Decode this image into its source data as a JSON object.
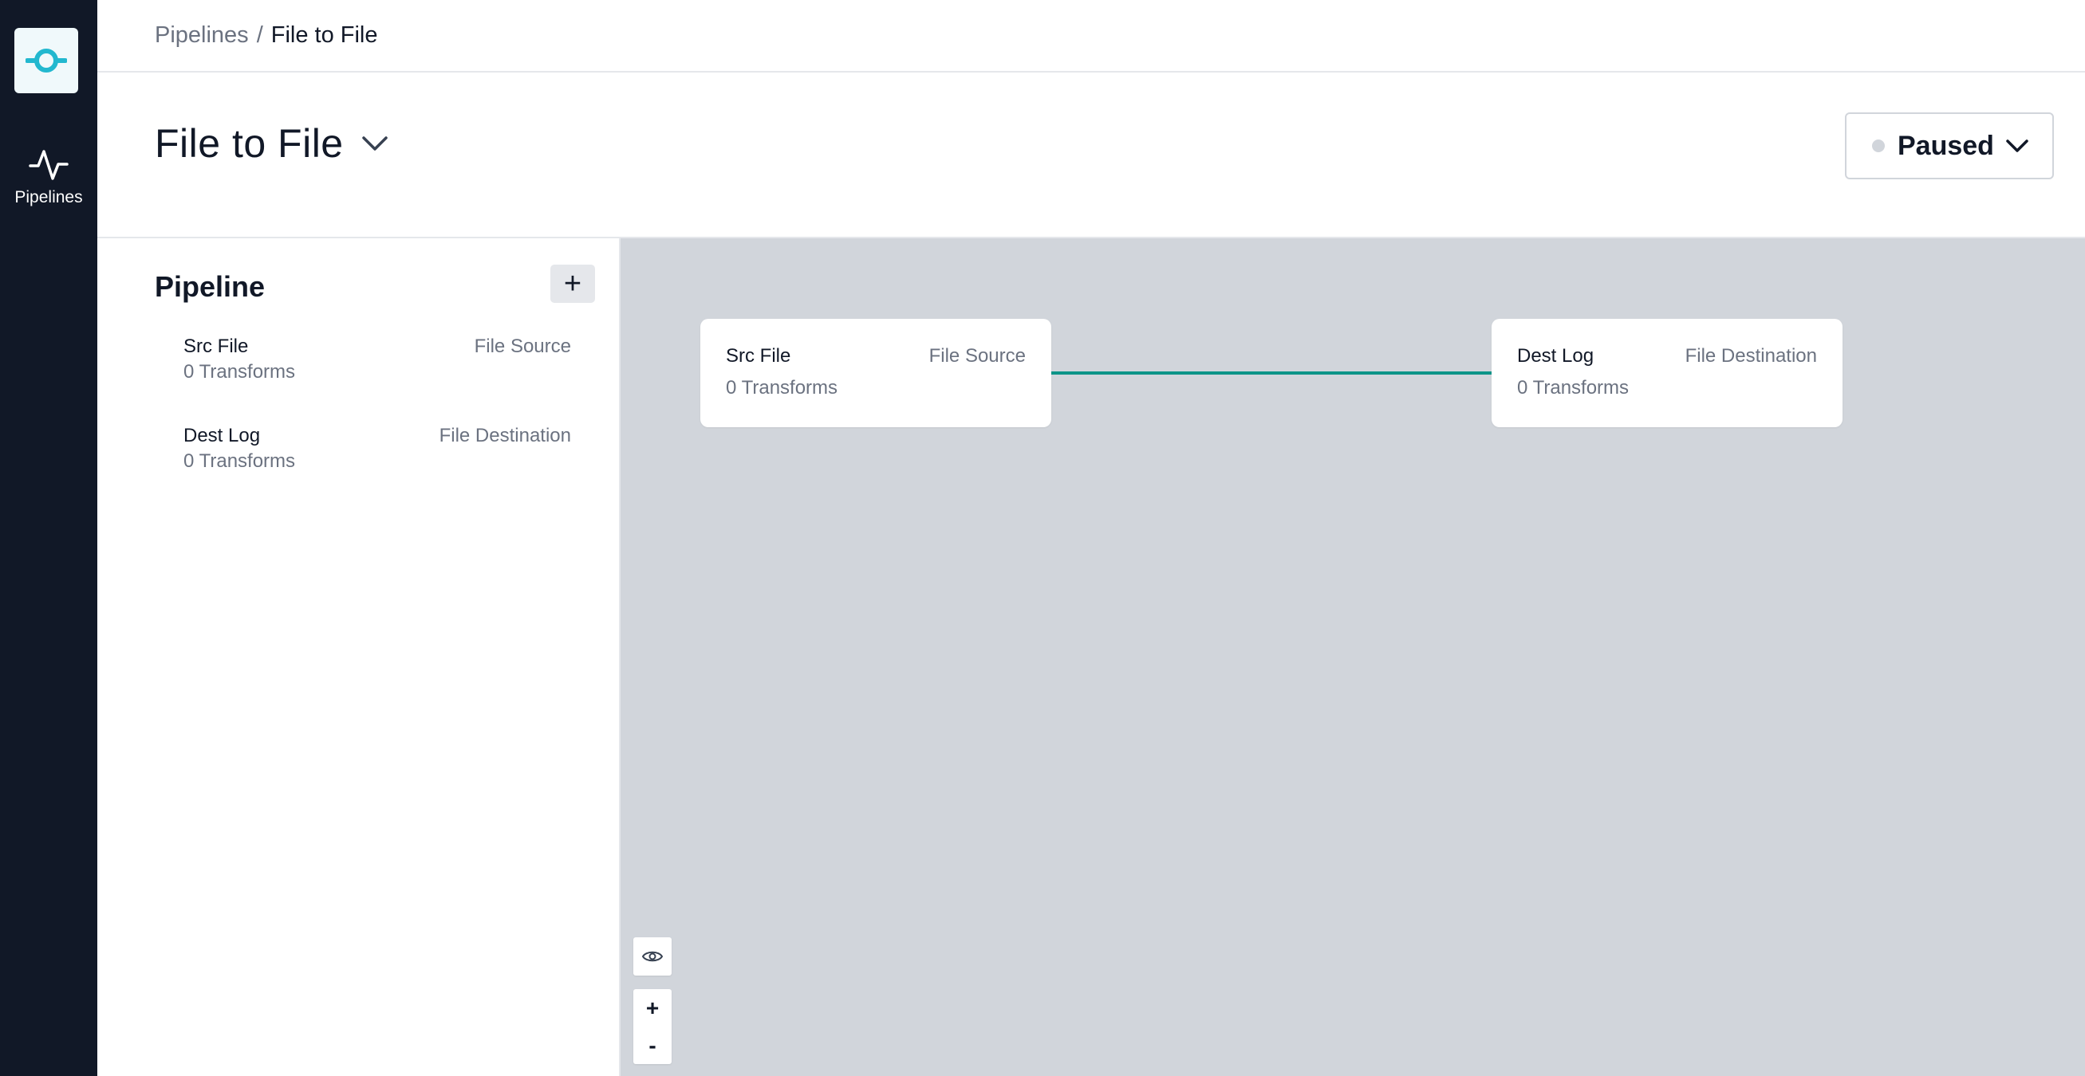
{
  "nav": {
    "logo_icon": "logo-icon",
    "items": [
      {
        "label": "Pipelines",
        "icon": "activity-pulse-icon"
      }
    ]
  },
  "breadcrumb": {
    "parent": "Pipelines",
    "separator": "/",
    "current": "File to File"
  },
  "header": {
    "title": "File to File",
    "title_menu_icon": "chevron-down-icon",
    "status": {
      "label": "Paused",
      "dot_color": "#d1d5db",
      "icon": "chevron-down-icon"
    }
  },
  "sidebar": {
    "title": "Pipeline",
    "add_label": "+",
    "items": [
      {
        "name": "Src File",
        "type": "File Source",
        "transforms": "0 Transforms"
      },
      {
        "name": "Dest Log",
        "type": "File Destination",
        "transforms": "0 Transforms"
      }
    ]
  },
  "canvas": {
    "background": "#d1d5db",
    "edge_color": "#0d9488",
    "nodes": [
      {
        "name": "Src File",
        "type": "File Source",
        "transforms": "0 Transforms"
      },
      {
        "name": "Dest Log",
        "type": "File Destination",
        "transforms": "0 Transforms"
      }
    ],
    "controls": {
      "visibility_icon": "eye-icon",
      "zoom_in": "+",
      "zoom_out": "-"
    }
  },
  "colors": {
    "rail": "#111827",
    "accent": "#22b8cf"
  }
}
